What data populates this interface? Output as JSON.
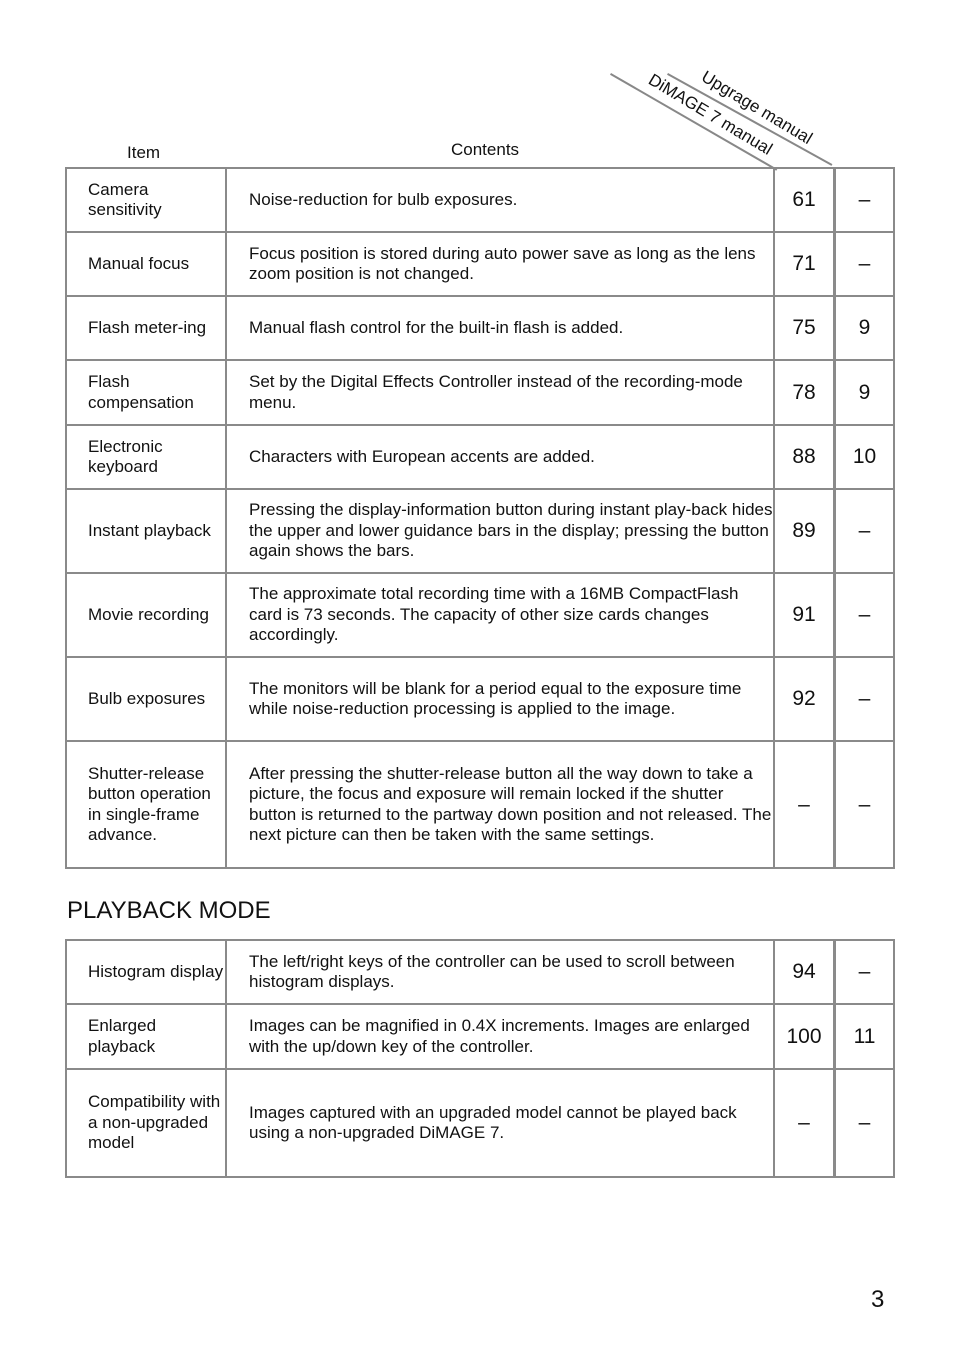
{
  "header": {
    "item_label": "Item",
    "contents_label": "Contents",
    "col3_label": "DiMAGE 7 manual",
    "col4_label": "Upgrage manual"
  },
  "recording_rows": [
    {
      "item": "Camera sensitivity",
      "content": "Noise-reduction for bulb exposures.",
      "dimage7": "61",
      "upgrade": "–"
    },
    {
      "item": "Manual focus",
      "content": "Focus position is stored during auto power save as long as the lens zoom position is not changed.",
      "dimage7": "71",
      "upgrade": "–"
    },
    {
      "item": "Flash meter-ing",
      "content": "Manual flash control for the built-in flash is added.",
      "dimage7": "75",
      "upgrade": "9"
    },
    {
      "item": "Flash compensation",
      "content": "Set by the Digital Effects Controller instead of the recording-mode menu.",
      "dimage7": "78",
      "upgrade": "9"
    },
    {
      "item": "Electronic keyboard",
      "content": "Characters with European accents are added.",
      "dimage7": "88",
      "upgrade": "10"
    },
    {
      "item": "Instant playback",
      "content": "Pressing the display-information button during instant play-back hides the upper and lower guidance bars in the display; pressing the button again shows the bars.",
      "dimage7": "89",
      "upgrade": "–"
    },
    {
      "item": "Movie recording",
      "content": "The approximate total recording time with a 16MB CompactFlash card is 73 seconds. The capacity of other size cards changes accordingly.",
      "dimage7": "91",
      "upgrade": "–"
    },
    {
      "item": "Bulb exposures",
      "content": "The monitors will be blank for a period equal to the exposure time while noise-reduction processing is applied to the image.",
      "dimage7": "92",
      "upgrade": "–"
    },
    {
      "item": "Shutter-release button operation in single-frame advance.",
      "content": "After pressing the shutter-release button all the way down to take a picture, the focus and exposure will remain locked if the shutter button is returned to the partway down position and not released. The next picture can then be taken with the same settings.",
      "dimage7": "–",
      "upgrade": "–"
    }
  ],
  "playback_section": {
    "title": "PLAYBACK MODE",
    "rows": [
      {
        "item": "Histogram display",
        "content": "The left/right keys of the controller can be used to scroll between histogram displays.",
        "dimage7": "94",
        "upgrade": "–"
      },
      {
        "item": "Enlarged playback",
        "content": "Images can be magnified in 0.4X increments. Images are enlarged with the up/down key of the controller.",
        "dimage7": "100",
        "upgrade": "11"
      },
      {
        "item": "Compatibility with a non-upgraded model",
        "content": "Images captured with an upgraded model cannot be played back using a non-upgraded DiMAGE 7.",
        "dimage7": "–",
        "upgrade": "–"
      }
    ]
  },
  "page_number": "3"
}
